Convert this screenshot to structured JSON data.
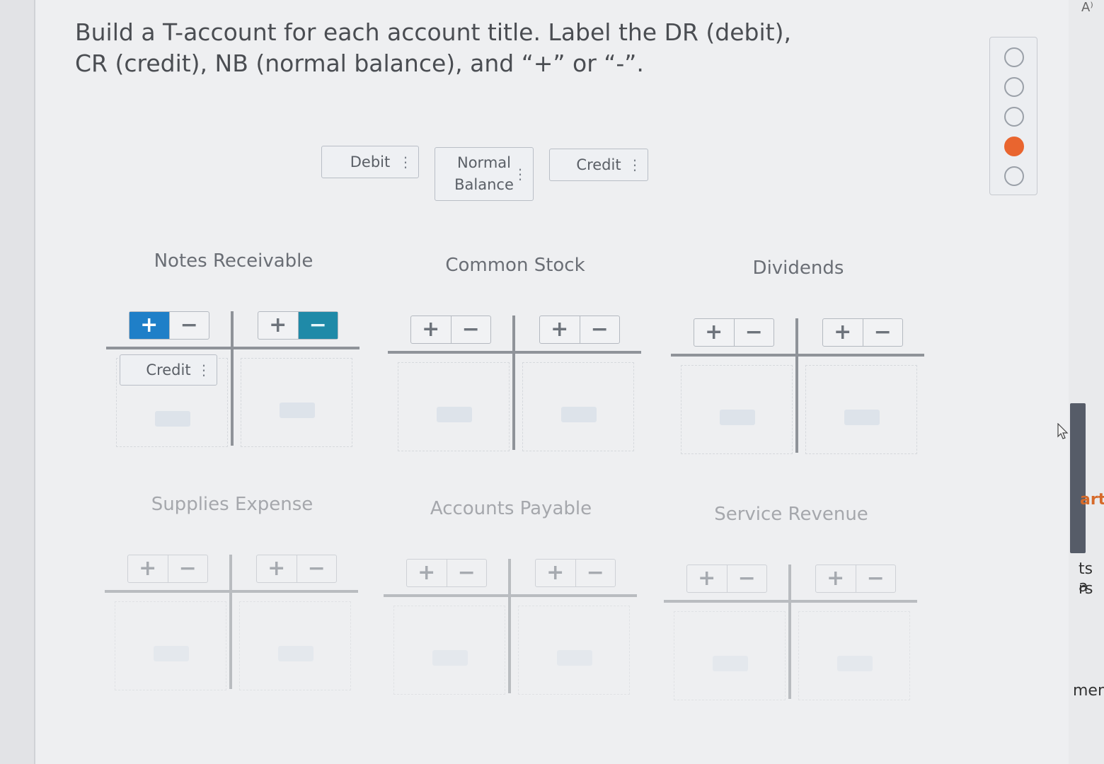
{
  "instructions": "Build a T-account for each account title. Label the DR (debit), CR (credit), NB (normal balance), and “+” or “-”.",
  "chips": {
    "debit": "Debit",
    "normal_balance_line1": "Normal",
    "normal_balance_line2": "Balance",
    "credit": "Credit",
    "grip": "⋮"
  },
  "buttons": {
    "plus": "+",
    "minus": "−"
  },
  "accounts": [
    {
      "title": "Notes Receivable",
      "left_placed": "Credit"
    },
    {
      "title": "Common Stock"
    },
    {
      "title": "Dividends"
    },
    {
      "title": "Supplies Expense"
    },
    {
      "title": "Accounts Payable"
    },
    {
      "title": "Service Revenue"
    }
  ],
  "side": {
    "corner": "A⁾",
    "frag1": "art",
    "frag2": "ts a",
    "frag3": "rs",
    "frag4": "men"
  },
  "colors": {
    "selected_plus": "#1f7fc8",
    "selected_minus": "#1f8aa8",
    "current_dot": "#e9652f"
  },
  "progress": {
    "total": 5,
    "current_index": 3
  }
}
